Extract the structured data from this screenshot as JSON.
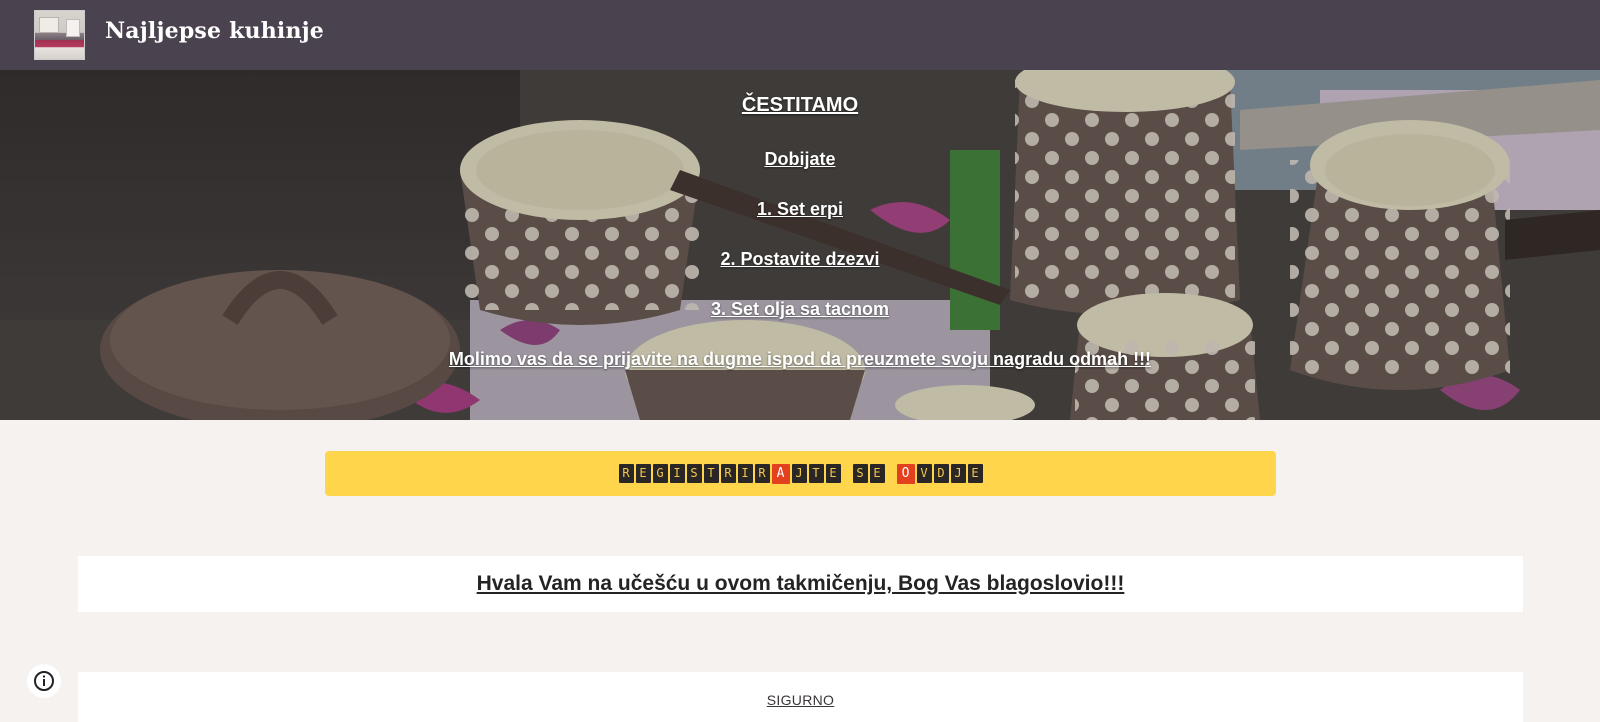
{
  "header": {
    "site_title": "Najljepse kuhinje",
    "bg_color": "#4a434f"
  },
  "hero": {
    "lines": [
      "ČESTITAMO",
      "Dobijate ",
      "1. Set erpi",
      "2. Postavite dzezvi",
      "3. Set olja sa tacnom",
      "Molimo vas da se prijavite na dugme ispod da preuzmete svoju nagradu odmah !!!"
    ]
  },
  "register_button": {
    "label": "REGISTRIRAJTE SE OVDJE",
    "highlighted_letters": [
      "A",
      "O"
    ],
    "bg_color": "#ffd54c"
  },
  "thanks": {
    "text": "Hvala Vam na učešću u ovom takmičenju, Bog Vas blagoslovio!!!"
  },
  "footer_box": {
    "link": "SIGURNO"
  },
  "icons": {
    "info": "info-icon"
  },
  "colors": {
    "page_bg": "#f5f2ef",
    "tile_dark": "#2a2626",
    "tile_text": "#f3c84a",
    "tile_red": "#e2401f"
  }
}
